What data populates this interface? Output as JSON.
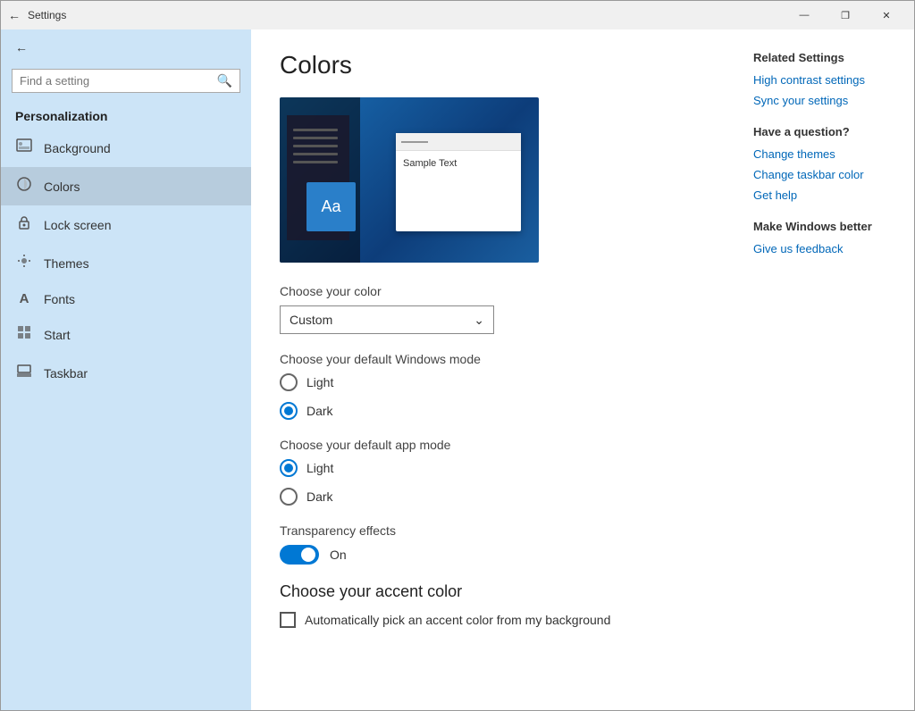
{
  "window": {
    "title": "Settings",
    "controls": {
      "minimize": "—",
      "maximize": "❐",
      "close": "✕"
    }
  },
  "sidebar": {
    "back_label": "←",
    "search_placeholder": "Find a setting",
    "section_title": "Personalization",
    "items": [
      {
        "id": "background",
        "label": "Background",
        "icon": "🖼"
      },
      {
        "id": "colors",
        "label": "Colors",
        "icon": "🎨",
        "active": true
      },
      {
        "id": "lock-screen",
        "label": "Lock screen",
        "icon": "🔒"
      },
      {
        "id": "themes",
        "label": "Themes",
        "icon": "🎭"
      },
      {
        "id": "fonts",
        "label": "Fonts",
        "icon": "A"
      },
      {
        "id": "start",
        "label": "Start",
        "icon": "⊞"
      },
      {
        "id": "taskbar",
        "label": "Taskbar",
        "icon": "▬"
      }
    ]
  },
  "main": {
    "page_title": "Colors",
    "preview": {
      "sample_text": "Sample Text"
    },
    "choose_color": {
      "label": "Choose your color",
      "dropdown_value": "Custom",
      "dropdown_arrow": "∨"
    },
    "windows_mode": {
      "label": "Choose your default Windows mode",
      "options": [
        {
          "id": "light",
          "label": "Light",
          "selected": false
        },
        {
          "id": "dark",
          "label": "Dark",
          "selected": true
        }
      ]
    },
    "app_mode": {
      "label": "Choose your default app mode",
      "options": [
        {
          "id": "light",
          "label": "Light",
          "selected": true
        },
        {
          "id": "dark",
          "label": "Dark",
          "selected": false
        }
      ]
    },
    "transparency": {
      "label": "Transparency effects",
      "toggle_state": "On"
    },
    "accent_color": {
      "heading": "Choose your accent color",
      "checkbox_label": "Automatically pick an accent color from my background"
    }
  },
  "right_panel": {
    "related_settings_title": "Related Settings",
    "links": [
      {
        "id": "high-contrast",
        "label": "High contrast settings"
      },
      {
        "id": "sync-settings",
        "label": "Sync your settings"
      }
    ],
    "have_question_title": "Have a question?",
    "question_links": [
      {
        "id": "change-themes",
        "label": "Change themes"
      },
      {
        "id": "change-taskbar-color",
        "label": "Change taskbar color"
      },
      {
        "id": "get-help",
        "label": "Get help"
      }
    ],
    "make_better_title": "Make Windows better",
    "feedback_link": "Give us feedback"
  }
}
